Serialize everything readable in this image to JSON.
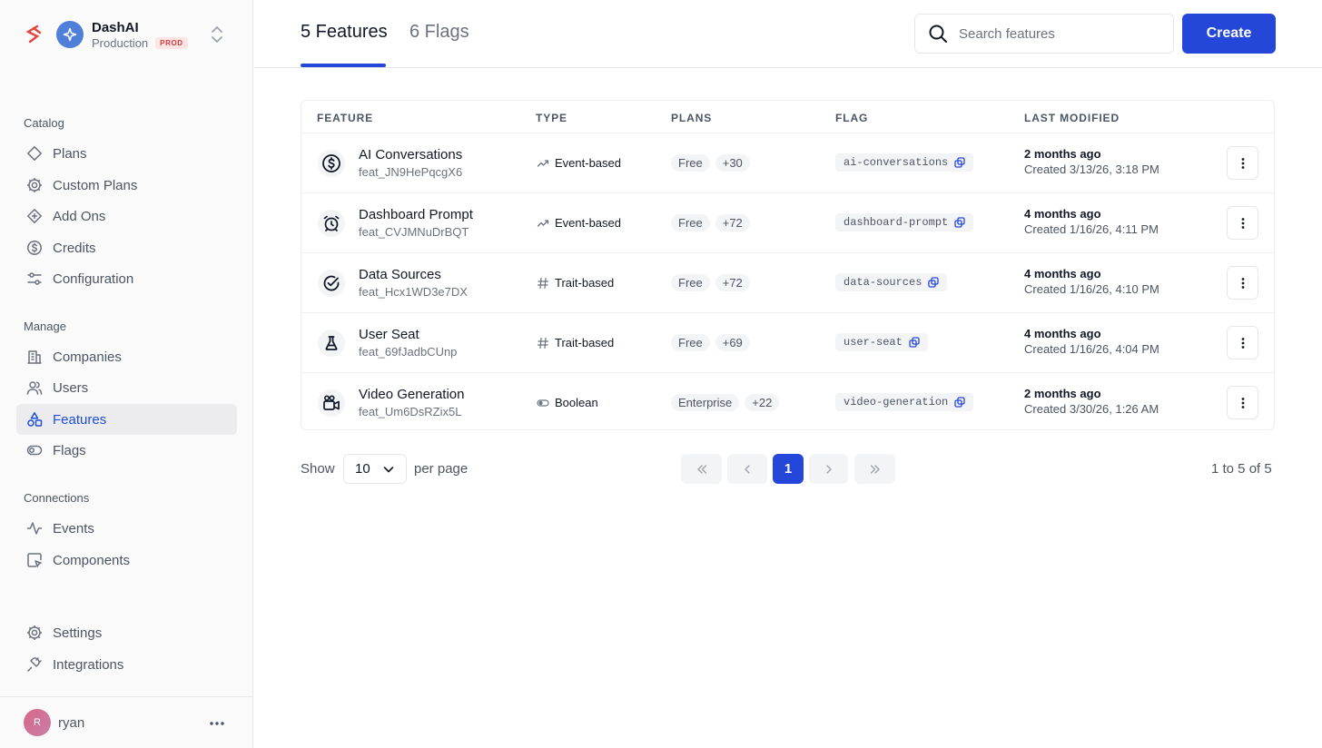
{
  "app": {
    "org_name": "DashAI",
    "env_name": "Production",
    "env_badge": "PROD"
  },
  "sidebar": {
    "sections": [
      {
        "label": "Catalog",
        "items": [
          {
            "label": "Plans",
            "icon": "tag-icon"
          },
          {
            "label": "Custom Plans",
            "icon": "gear-icon"
          },
          {
            "label": "Add Ons",
            "icon": "diamond-plus-icon"
          },
          {
            "label": "Credits",
            "icon": "dollar-circle-icon"
          },
          {
            "label": "Configuration",
            "icon": "sliders-icon"
          }
        ]
      },
      {
        "label": "Manage",
        "items": [
          {
            "label": "Companies",
            "icon": "building-icon"
          },
          {
            "label": "Users",
            "icon": "users-icon"
          },
          {
            "label": "Features",
            "icon": "shapes-icon",
            "active": true
          },
          {
            "label": "Flags",
            "icon": "toggle-icon"
          }
        ]
      },
      {
        "label": "Connections",
        "items": [
          {
            "label": "Events",
            "icon": "activity-icon"
          },
          {
            "label": "Components",
            "icon": "component-icon"
          }
        ]
      }
    ],
    "bottom_items": [
      {
        "label": "Settings",
        "icon": "gear-icon"
      },
      {
        "label": "Integrations",
        "icon": "plug-icon"
      }
    ],
    "user": {
      "initial": "R",
      "name": "ryan"
    }
  },
  "header": {
    "tabs": [
      {
        "label": "5 Features",
        "active": true
      },
      {
        "label": "6 Flags",
        "active": false
      }
    ],
    "search_placeholder": "Search features",
    "create_label": "Create"
  },
  "table": {
    "columns": [
      "FEATURE",
      "TYPE",
      "PLANS",
      "FLAG",
      "LAST MODIFIED"
    ],
    "rows": [
      {
        "icon": "dollar-circle-icon",
        "name": "AI Conversations",
        "id": "feat_JN9HePqcgX6",
        "type": "Event-based",
        "type_icon": "trend-icon",
        "plan": "Free",
        "plan_more": "+30",
        "flag": "ai-conversations",
        "modified": "2 months ago",
        "created": "Created 3/13/26, 3:18 PM"
      },
      {
        "icon": "alarm-clock-icon",
        "name": "Dashboard Prompt",
        "id": "feat_CVJMNuDrBQT",
        "type": "Event-based",
        "type_icon": "trend-icon",
        "plan": "Free",
        "plan_more": "+72",
        "flag": "dashboard-prompt",
        "modified": "4 months ago",
        "created": "Created 1/16/26, 4:11 PM"
      },
      {
        "icon": "check-circle-icon",
        "name": "Data Sources",
        "id": "feat_Hcx1WD3e7DX",
        "type": "Trait-based",
        "type_icon": "hash-icon",
        "plan": "Free",
        "plan_more": "+72",
        "flag": "data-sources",
        "modified": "4 months ago",
        "created": "Created 1/16/26, 4:10 PM"
      },
      {
        "icon": "flask-icon",
        "name": "User Seat",
        "id": "feat_69fJadbCUnp",
        "type": "Trait-based",
        "type_icon": "hash-icon",
        "plan": "Free",
        "plan_more": "+69",
        "flag": "user-seat",
        "modified": "4 months ago",
        "created": "Created 1/16/26, 4:04 PM"
      },
      {
        "icon": "video-camera-icon",
        "name": "Video Generation",
        "id": "feat_Um6DsRZix5L",
        "type": "Boolean",
        "type_icon": "toggle-icon",
        "plan": "Enterprise",
        "plan_more": "+22",
        "flag": "video-generation",
        "modified": "2 months ago",
        "created": "Created 3/30/26, 1:26 AM"
      }
    ]
  },
  "pagination": {
    "show_label": "Show",
    "per_page_value": "10",
    "per_page_label": "per page",
    "current_page": "1",
    "range": "1 to 5 of 5"
  },
  "colors": {
    "accent": "#2547d9",
    "brand_mark": "#e0463e",
    "prod_badge_text": "#d23c3c",
    "prod_badge_bg": "#fde5e5"
  }
}
